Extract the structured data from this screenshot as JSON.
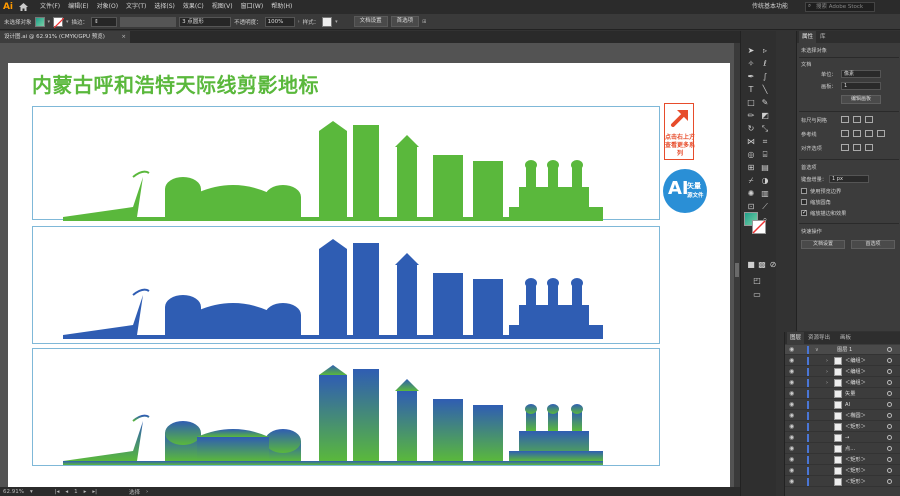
{
  "app": {
    "logo": "Ai",
    "menu": [
      "文件(F)",
      "编辑(E)",
      "对象(O)",
      "文字(T)",
      "选择(S)",
      "效果(C)",
      "视图(V)",
      "窗口(W)",
      "帮助(H)"
    ],
    "workspace": "传统基本功能",
    "search_placeholder": "搜索 Adobe Stock"
  },
  "control_bar": {
    "selection": "未选择对象",
    "stroke_label": "描边：",
    "brush_value": "3 点圆形",
    "opacity_label": "不透明度：",
    "opacity_value": "100%",
    "style_label": "样式：",
    "doc_setup": "文档设置",
    "preferences": "首选项"
  },
  "tab": {
    "title": "设计图.ai @ 62.91% (CMYK/GPU 预览)",
    "close": "×"
  },
  "artboard": {
    "title": "内蒙古呼和浩特天际线剪影地标",
    "promo_text": [
      "点击右上方",
      "查看更多系列"
    ],
    "badge": {
      "ai": "AI",
      "line1": "矢量",
      "line2": "源文件"
    },
    "skylines": [
      {
        "color_top": "#5ab83c",
        "color_bottom": "#5ab83c"
      },
      {
        "color_top": "#2f5db3",
        "color_bottom": "#2f5db3"
      },
      {
        "color_top": "#2f5db3",
        "color_bottom": "#5ab83c"
      }
    ]
  },
  "status": {
    "zoom": "62.91%",
    "page": "1",
    "mode": "选择"
  },
  "properties": {
    "tabs": [
      "属性",
      "库"
    ],
    "no_selection": "未选择对象",
    "doc_section": "文档",
    "unit_label": "单位：",
    "unit_value": "像素",
    "artboard_label": "画板：",
    "artboard_value": "1",
    "edit_artboard": "编辑画板",
    "ruler_grid": "标尺与网格",
    "guides": "参考线",
    "snap": "对齐选项",
    "prefs_section": "首选项",
    "keyboard_inc_label": "键盘增量：",
    "keyboard_inc_value": "1 px",
    "check_preview": "使用预览边界",
    "check_corners": "缩放圆角",
    "check_strokes": "缩放描边和效果",
    "quick_actions": "快速操作",
    "doc_setup_btn": "文档设置",
    "prefs_btn": "首选项"
  },
  "layers": {
    "tabs": [
      "图层",
      "资源导出",
      "画板"
    ],
    "rows": [
      {
        "name": "图层 1",
        "arrow": "∨"
      },
      {
        "name": "＜编组＞",
        "arrow": "›"
      },
      {
        "name": "＜编组＞",
        "arrow": "›"
      },
      {
        "name": "＜编组＞",
        "arrow": "›"
      },
      {
        "name": "矢量",
        "arrow": ""
      },
      {
        "name": "AI",
        "arrow": ""
      },
      {
        "name": "＜椭圆＞",
        "arrow": ""
      },
      {
        "name": "＜矩形＞",
        "arrow": ""
      },
      {
        "name": "→",
        "arrow": ""
      },
      {
        "name": "点...",
        "arrow": ""
      },
      {
        "name": "＜矩形＞",
        "arrow": ""
      },
      {
        "name": "＜矩形＞",
        "arrow": ""
      },
      {
        "name": "＜矩形＞",
        "arrow": ""
      }
    ]
  }
}
